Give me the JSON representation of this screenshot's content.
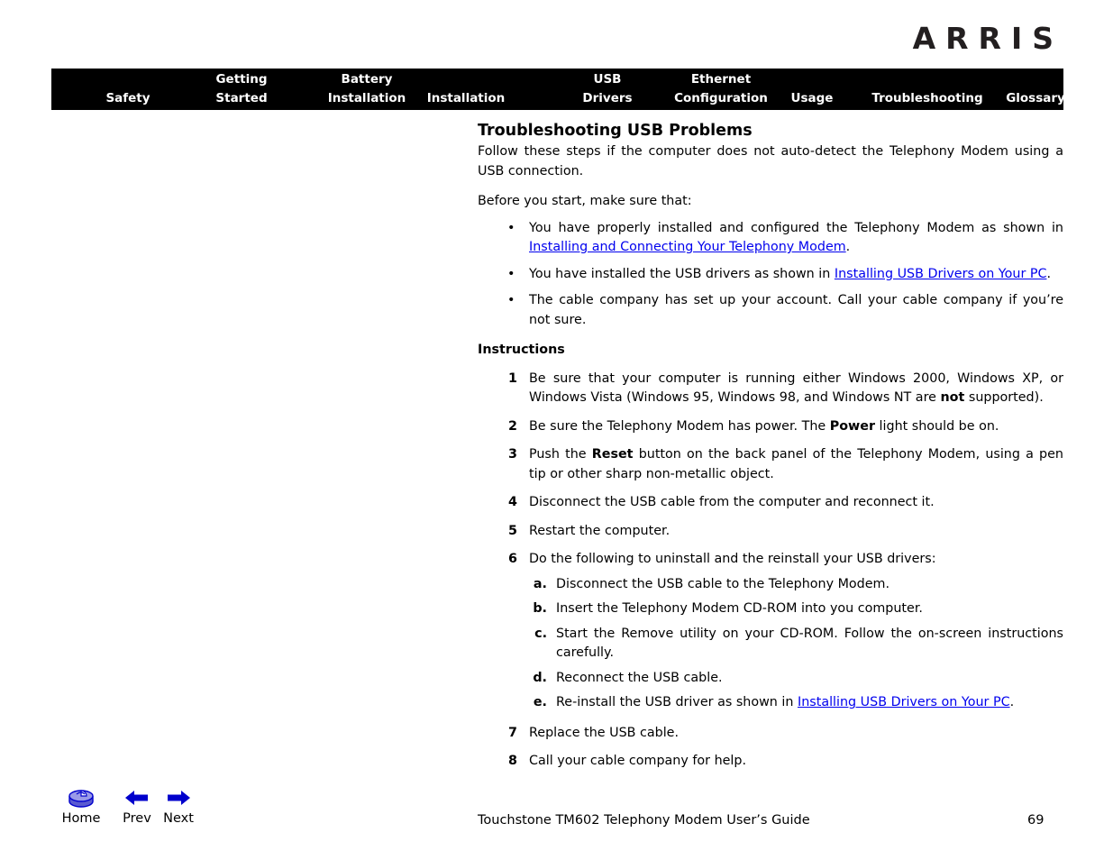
{
  "header": {
    "brand": "ARRIS"
  },
  "nav": {
    "items": [
      {
        "id": "safety",
        "line1": "",
        "line2": "Safety"
      },
      {
        "id": "getting",
        "line1": "Getting",
        "line2": "Started"
      },
      {
        "id": "battery",
        "line1": "Battery",
        "line2": "Installation"
      },
      {
        "id": "install",
        "line1": "",
        "line2": "Installation"
      },
      {
        "id": "usb",
        "line1": "USB",
        "line2": "Drivers"
      },
      {
        "id": "ethernet",
        "line1": "Ethernet",
        "line2": "Configuration"
      },
      {
        "id": "usage",
        "line1": "",
        "line2": "Usage"
      },
      {
        "id": "trouble",
        "line1": "",
        "line2": "Troubleshooting"
      },
      {
        "id": "glossary",
        "line1": "",
        "line2": "Glossary"
      }
    ]
  },
  "content": {
    "title": "Troubleshooting USB Problems",
    "intro": "Follow these steps if the computer does not auto-detect the Telephony Modem using a USB connection.",
    "before_you_start": "Before you start, make sure that:",
    "bullet_marker": "•",
    "prereqs": [
      {
        "pre": "You have properly installed and configured the Telephony Modem as shown in ",
        "link": "Installing and Connecting Your Telephony Modem",
        "post": "."
      },
      {
        "pre": "You have installed the USB drivers as shown in ",
        "link": "Installing USB Drivers on Your PC",
        "post": "."
      },
      {
        "pre": "The cable company has set up your account. Call your cable company if you’re not sure.",
        "link": "",
        "post": ""
      }
    ],
    "instructions_heading": "Instructions",
    "steps": [
      {
        "num": "1",
        "seg1": "Be sure that your computer is running either Windows 2000, Windows XP, or Windows Vista (Windows 95, Windows 98, and Windows NT are ",
        "bold": "not",
        "seg2": " supported)."
      },
      {
        "num": "2",
        "seg1": "Be sure the Telephony Modem has power. The ",
        "bold": "Power",
        "seg2": " light should be on."
      },
      {
        "num": "3",
        "seg1": "Push the ",
        "bold": "Reset",
        "seg2": " button on the back panel of the Telephony Modem, using a pen tip or other sharp non-metallic object."
      },
      {
        "num": "4",
        "seg1": "Disconnect the USB cable from the computer and reconnect it.",
        "bold": "",
        "seg2": ""
      },
      {
        "num": "5",
        "seg1": "Restart the computer.",
        "bold": "",
        "seg2": ""
      },
      {
        "num": "6",
        "seg1": "Do the following to uninstall and the reinstall your USB drivers:",
        "bold": "",
        "seg2": ""
      },
      {
        "num": "7",
        "seg1": "Replace the USB cable.",
        "bold": "",
        "seg2": ""
      },
      {
        "num": "8",
        "seg1": "Call your cable company for help.",
        "bold": "",
        "seg2": ""
      }
    ],
    "substeps": [
      {
        "letter": "a.",
        "pre": "Disconnect the USB cable to the Telephony Modem.",
        "link": "",
        "post": ""
      },
      {
        "letter": "b.",
        "pre": "Insert the Telephony Modem CD-ROM into you computer.",
        "link": "",
        "post": ""
      },
      {
        "letter": "c.",
        "pre": "Start the Remove utility on your CD-ROM. Follow the on-screen instructions carefully.",
        "link": "",
        "post": ""
      },
      {
        "letter": "d.",
        "pre": "Reconnect the USB cable.",
        "link": "",
        "post": ""
      },
      {
        "letter": "e.",
        "pre": "Re-install the USB driver as shown in ",
        "link": "Installing USB Drivers on Your PC",
        "post": "."
      }
    ]
  },
  "footer": {
    "home_label": "Home",
    "prev_label": "Prev",
    "next_label": "Next",
    "home_icon": "home-disc-icon",
    "prev_icon": "arrow-left-icon",
    "next_icon": "arrow-right-icon",
    "caption": "Touchstone TM602 Telephony Modem User’s Guide",
    "page_number": "69"
  },
  "colors": {
    "nav_background": "#000000",
    "nav_text": "#ffffff",
    "link": "#0000ee",
    "icon_blue": "#0000cc",
    "brand": "#231f20"
  }
}
